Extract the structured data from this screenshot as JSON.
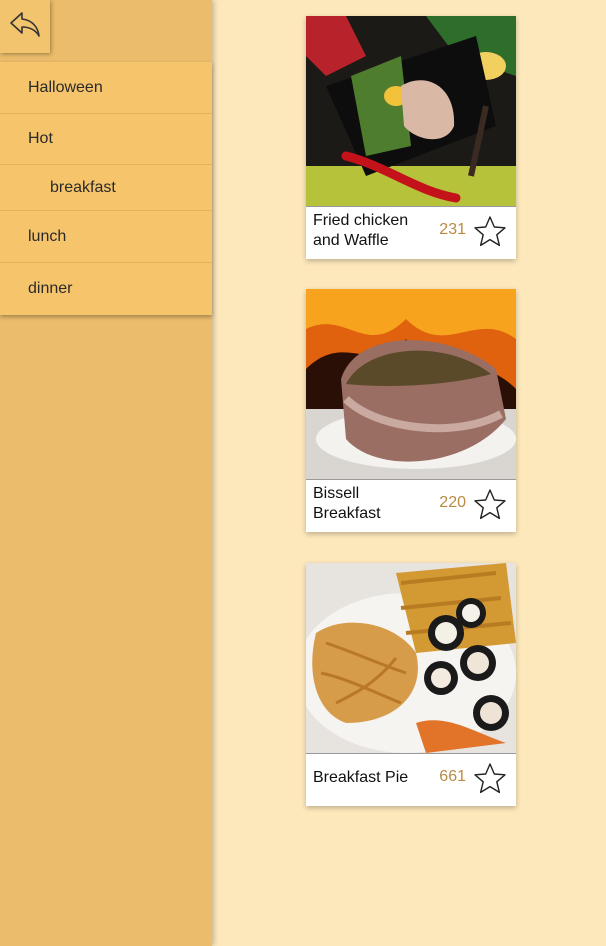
{
  "sidebar": {
    "back_icon": "reply-arrow-icon",
    "menu": [
      {
        "label": "Halloween"
      },
      {
        "label": "Hot"
      },
      {
        "label": "breakfast"
      },
      {
        "label": "lunch"
      },
      {
        "label": "dinner"
      }
    ]
  },
  "recipes": [
    {
      "name": "Fried chicken and Waffle",
      "count": "231",
      "favorite_icon": "star-outline-icon",
      "photo": "plated chicken breast with green beans, corn and red chili peppers"
    },
    {
      "name": "Bissell Breakfast",
      "count": "220",
      "favorite_icon": "star-outline-icon",
      "photo": "grilled pork chop with chives in front of fire"
    },
    {
      "name": "Breakfast Pie",
      "count": "661",
      "favorite_icon": "star-outline-icon",
      "photo": "plate of noodles, sushi rolls and spring rolls"
    }
  ],
  "colors": {
    "page_bg": "#fde8bb",
    "sidebar_bg": "#eabc6b",
    "menu_bg": "#f6c46a",
    "count_text": "#b98a44"
  }
}
